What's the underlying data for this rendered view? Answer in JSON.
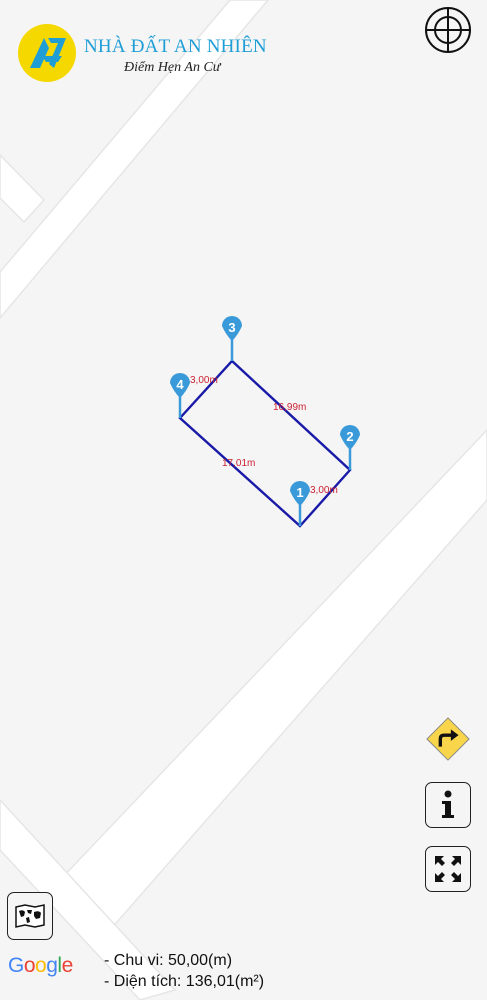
{
  "brand": {
    "title": "NHÀ ĐẤT AN NHIÊN",
    "subtitle": "Điểm Hẹn An Cư",
    "colors": {
      "title": "#1f9ed6",
      "badge": "#f5d800"
    }
  },
  "map": {
    "provider": "Google",
    "road_color": "#ffffff",
    "background_color": "#f5f5f5"
  },
  "parcel": {
    "outline_color": "#1a1aa8",
    "marker_color": "#3a9ad9",
    "label_color": "#cc2233",
    "markers": [
      "1",
      "2",
      "3",
      "4"
    ],
    "edge_labels": {
      "edge_1_2": "3,00m",
      "edge_2_3": "16,99m",
      "edge_3_4": "3,00m",
      "edge_4_1": "17,01m"
    }
  },
  "controls": {
    "locate": "crosshair-icon",
    "directions": "turn-right-sign-icon",
    "info": "info-icon",
    "fullscreen": "expand-arrows-icon",
    "map_type": "world-map-icon"
  },
  "stats": {
    "perimeter": "- Chu vi: 50,00(m)",
    "area": "- Diện tích: 136,01(m²)"
  }
}
